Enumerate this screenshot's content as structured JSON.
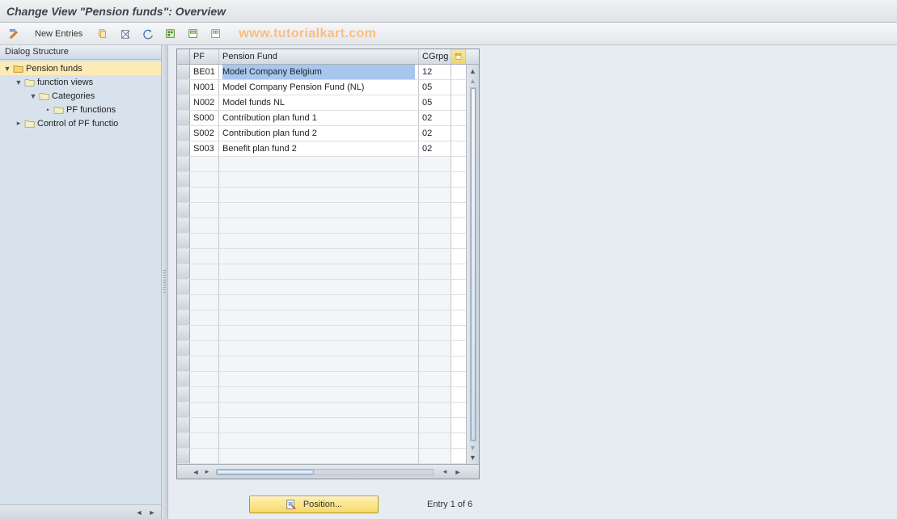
{
  "title": "Change View \"Pension funds\": Overview",
  "watermark": "www.tutorialkart.com",
  "toolbar": {
    "new_entries_label": "New Entries"
  },
  "dialog_structure": {
    "header": "Dialog Structure",
    "tree": [
      {
        "label": "Pension funds",
        "level": 0,
        "open": true,
        "selected": true
      },
      {
        "label": "function views",
        "level": 1,
        "open": true,
        "selected": false
      },
      {
        "label": "Categories",
        "level": 2,
        "open": true,
        "selected": false
      },
      {
        "label": "PF functions",
        "level": 3,
        "open": false,
        "selected": false
      },
      {
        "label": "Control of PF functio",
        "level": 1,
        "open": false,
        "selected": false
      }
    ]
  },
  "grid": {
    "columns": {
      "pf": "PF",
      "name": "Pension Fund",
      "cgrpg": "CGrpg"
    },
    "rows": [
      {
        "pf": "BE01",
        "name": "Model Company Belgium",
        "cgrpg": "12",
        "selected": true
      },
      {
        "pf": "N001",
        "name": "Model Company Pension Fund (NL)",
        "cgrpg": "05",
        "selected": false
      },
      {
        "pf": "N002",
        "name": "Model funds NL",
        "cgrpg": "05",
        "selected": false
      },
      {
        "pf": "S000",
        "name": "Contribution plan fund 1",
        "cgrpg": "02",
        "selected": false
      },
      {
        "pf": "S002",
        "name": "Contribution plan fund 2",
        "cgrpg": "02",
        "selected": false
      },
      {
        "pf": "S003",
        "name": "Benefit plan fund 2",
        "cgrpg": "02",
        "selected": false
      }
    ],
    "empty_rows": 20
  },
  "footer": {
    "position_label": "Position...",
    "entry_text": "Entry 1 of 6"
  }
}
